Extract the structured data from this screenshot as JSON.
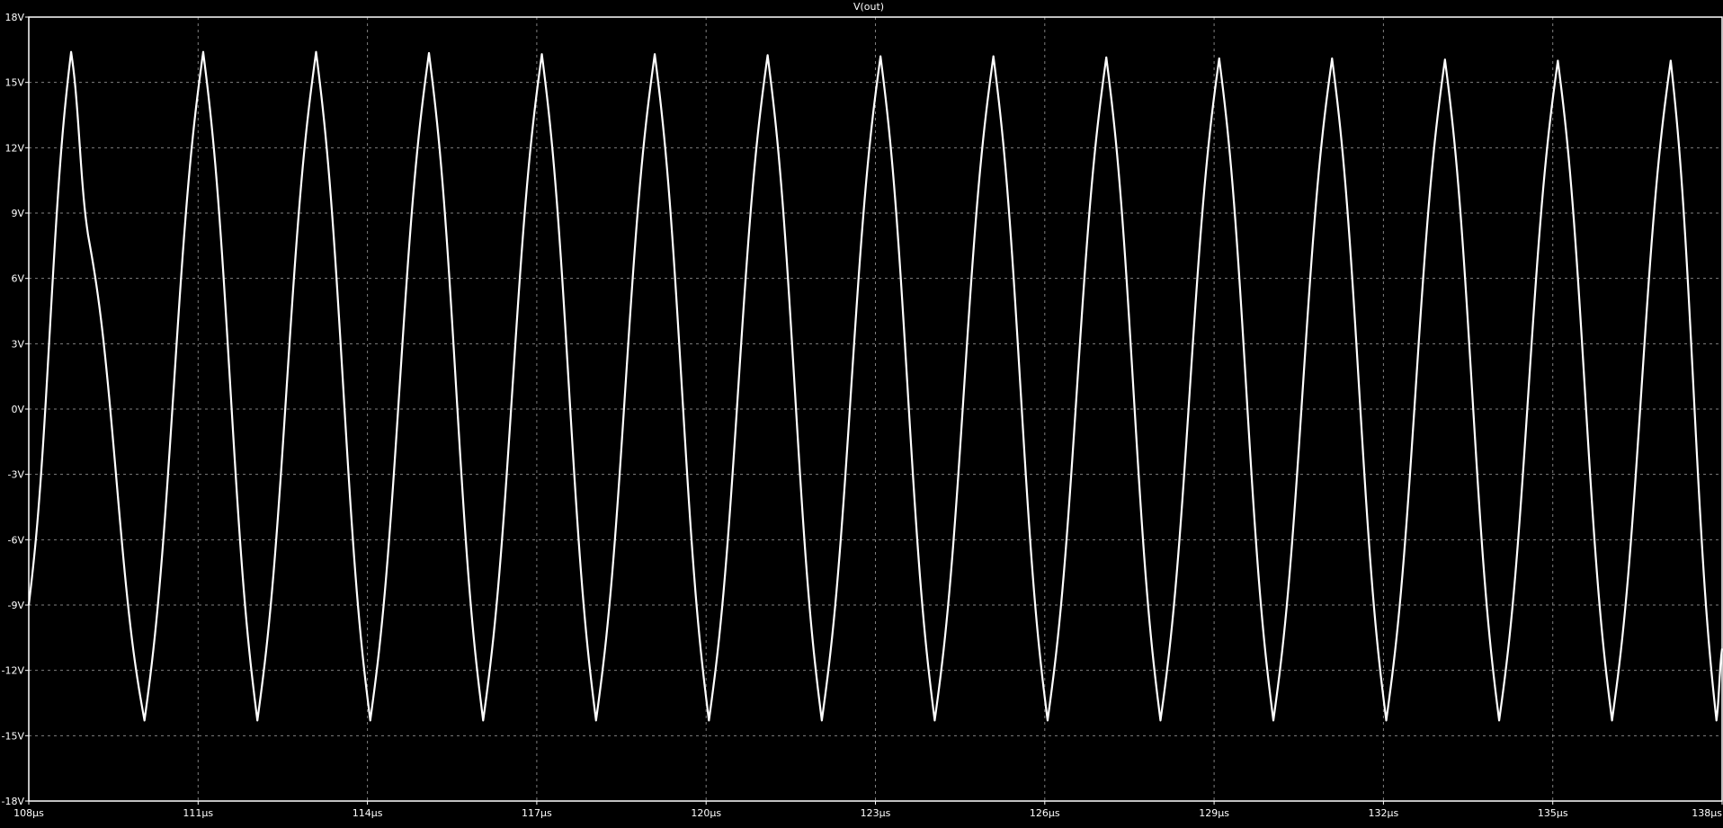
{
  "colors": {
    "background": "#000000",
    "trace": "#ffffff",
    "axes": "#ffffff",
    "grid": "#808080",
    "text": "#ffffff"
  },
  "chart_data": {
    "type": "line",
    "title": "V(out)",
    "xlabel": "",
    "ylabel": "",
    "xlim": [
      108,
      138
    ],
    "ylim": [
      -18,
      18
    ],
    "x_unit": "µs",
    "y_unit": "V",
    "grid": true,
    "grid_style": "dashed",
    "x_ticks": [
      108,
      111,
      114,
      117,
      120,
      123,
      126,
      129,
      132,
      135,
      138
    ],
    "x_tick_labels": [
      "108µs",
      "111µs",
      "114µs",
      "117µs",
      "120µs",
      "123µs",
      "126µs",
      "129µs",
      "132µs",
      "135µs",
      "138µs"
    ],
    "y_ticks": [
      18,
      15,
      12,
      9,
      6,
      3,
      0,
      -3,
      -6,
      -9,
      -12,
      -15,
      -18
    ],
    "y_tick_labels": [
      "18V",
      "15V",
      "12V",
      "9V",
      "6V",
      "3V",
      "0V",
      "-3V",
      "-6V",
      "-9V",
      "-12V",
      "-15V",
      "-18V"
    ],
    "series": [
      {
        "name": "V(out)",
        "x": [
          108.0,
          108.75,
          109.05,
          110.05,
          111.09,
          112.05,
          113.09,
          114.05,
          115.09,
          116.05,
          117.09,
          118.05,
          119.09,
          120.05,
          121.09,
          122.05,
          123.09,
          124.05,
          125.09,
          126.05,
          127.09,
          128.05,
          129.09,
          130.05,
          131.09,
          132.05,
          133.09,
          134.05,
          135.09,
          136.05,
          137.09,
          137.9,
          138.0
        ],
        "y": [
          -9.0,
          16.4,
          8.0,
          -14.3,
          16.4,
          -14.3,
          16.4,
          -14.3,
          16.35,
          -14.3,
          16.3,
          -14.3,
          16.3,
          -14.3,
          16.25,
          -14.3,
          16.2,
          -14.3,
          16.2,
          -14.3,
          16.15,
          -14.3,
          16.1,
          -14.3,
          16.1,
          -14.3,
          16.05,
          -14.3,
          16.0,
          -14.3,
          16.0,
          -14.3,
          -11.0
        ]
      }
    ]
  }
}
